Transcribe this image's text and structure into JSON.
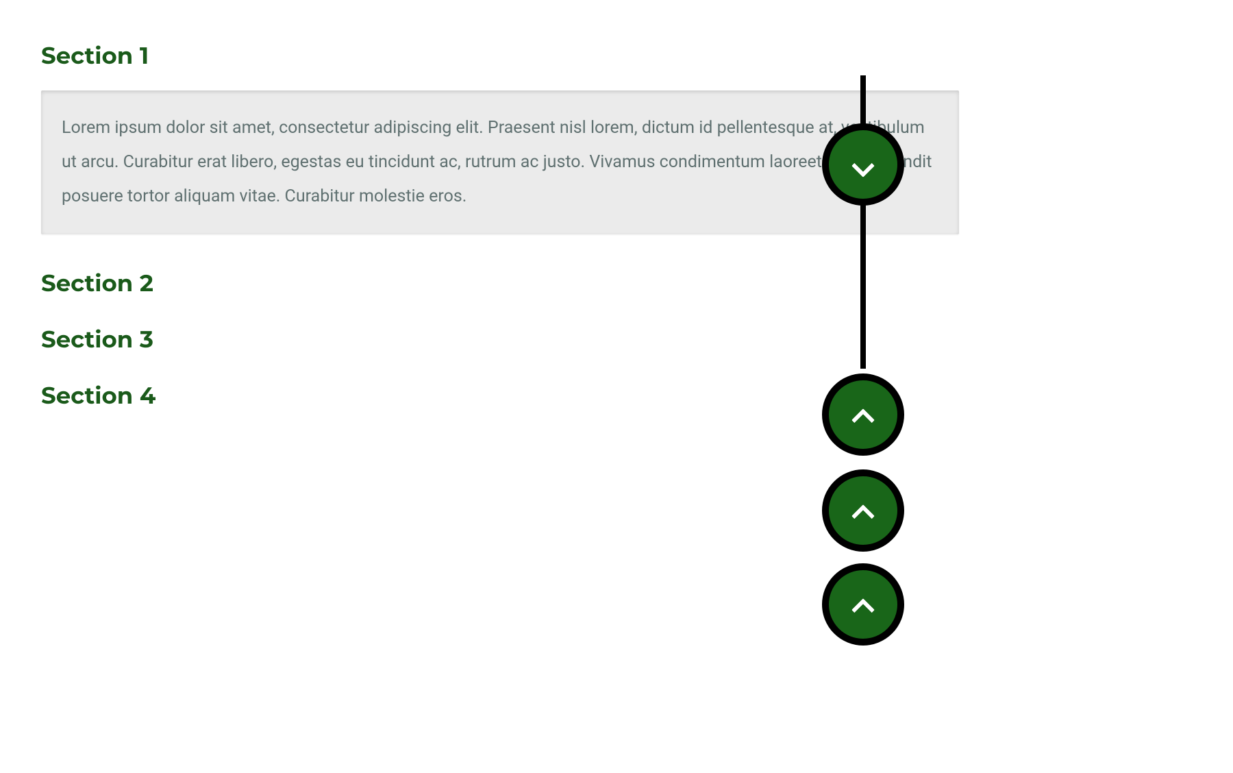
{
  "sections": [
    {
      "title": "Section 1",
      "expanded": true,
      "content": "Lorem ipsum dolor sit amet, consectetur adipiscing elit. Praesent nisl lorem, dictum id pellentesque at, vestibulum ut arcu. Curabitur erat libero, egestas eu tincidunt ac, rutrum ac justo. Vivamus condimentum laoreet lectus, blandit posuere tortor aliquam vitae. Curabitur molestie eros."
    },
    {
      "title": "Section 2",
      "expanded": false,
      "content": ""
    },
    {
      "title": "Section 3",
      "expanded": false,
      "content": ""
    },
    {
      "title": "Section 4",
      "expanded": false,
      "content": ""
    }
  ],
  "colors": {
    "heading": "#1a5a1a",
    "nodeFill": "#196619",
    "nodeBorder": "#000000",
    "contentBg": "#ebebeb",
    "contentText": "#5f7070"
  },
  "timeline": {
    "nodePositions": [
      70,
      435,
      575,
      712
    ]
  }
}
